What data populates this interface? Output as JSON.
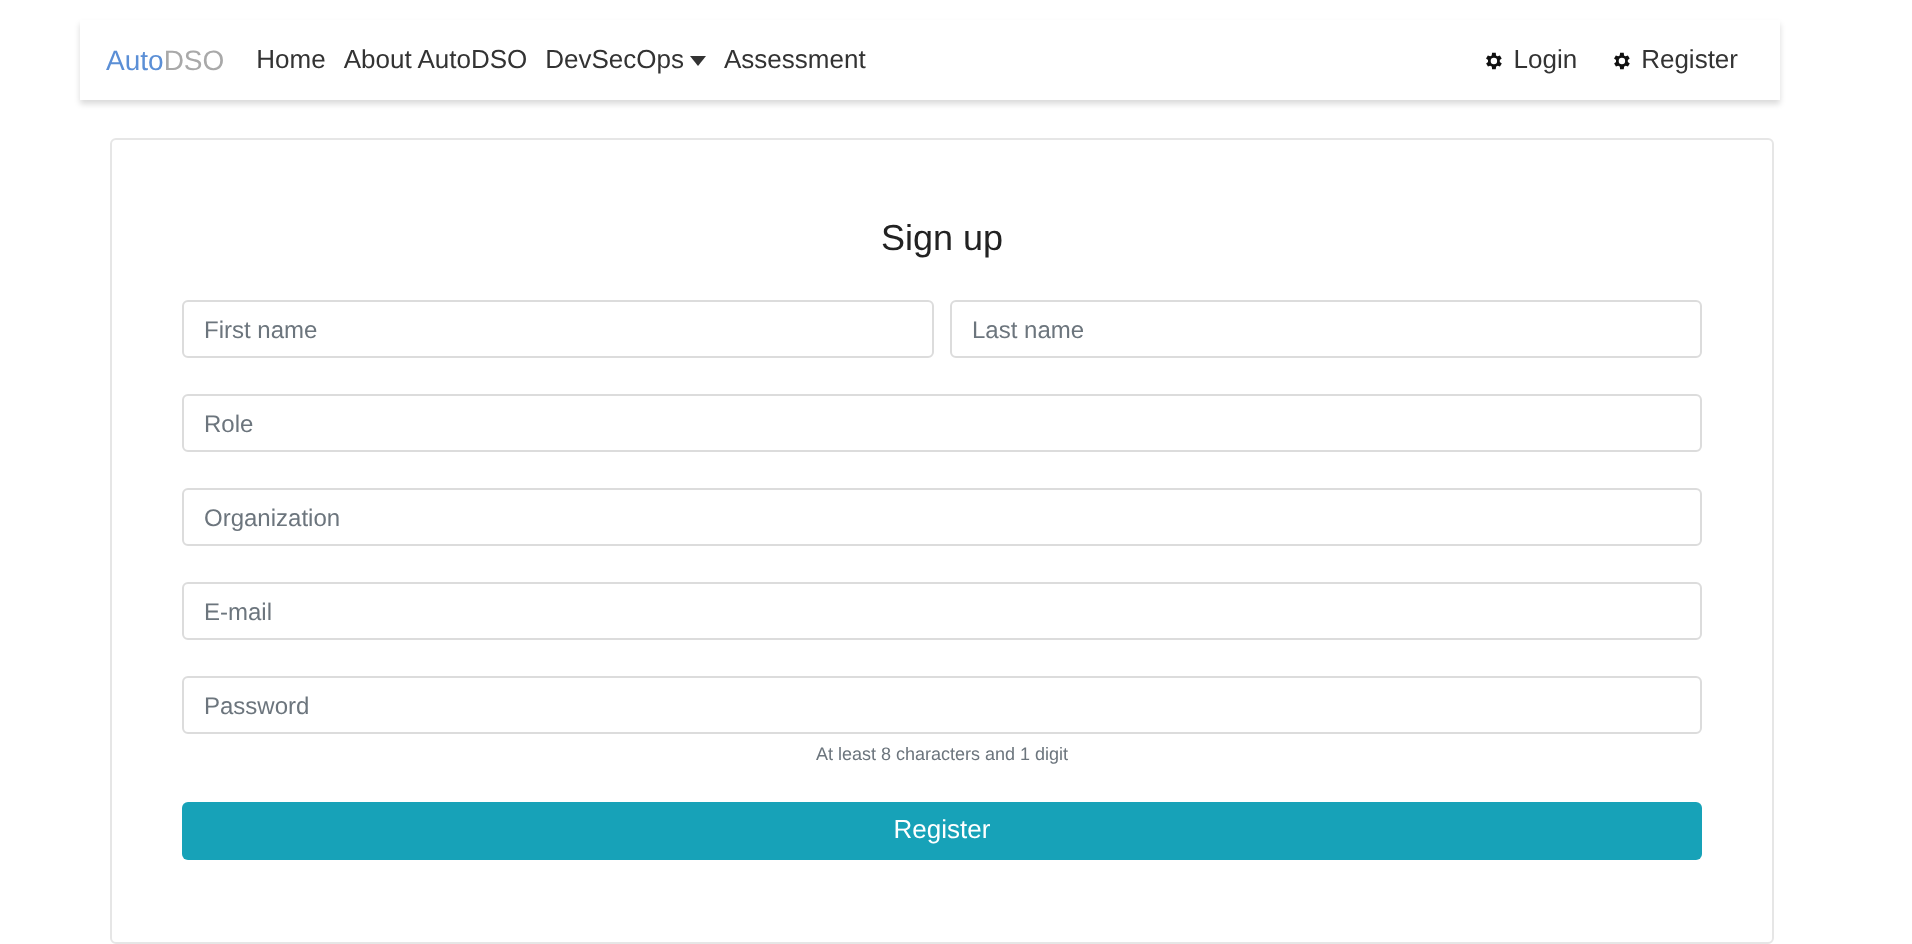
{
  "navbar": {
    "brand": {
      "primary": "Auto",
      "secondary": "DSO"
    },
    "links": [
      {
        "label": "Home",
        "kind": "link"
      },
      {
        "label": "About AutoDSO",
        "kind": "link"
      },
      {
        "label": "DevSecOps",
        "kind": "dropdown"
      },
      {
        "label": "Assessment",
        "kind": "link"
      }
    ],
    "account_links": [
      {
        "label": "Login"
      },
      {
        "label": "Register"
      }
    ]
  },
  "form": {
    "title": "Sign up",
    "rows": [
      [
        {
          "placeholder": "First name"
        },
        {
          "placeholder": "Last name"
        }
      ],
      [
        {
          "placeholder": "Role"
        }
      ],
      [
        {
          "placeholder": "Organization"
        }
      ],
      [
        {
          "placeholder": "E-mail"
        }
      ],
      [
        {
          "placeholder": "Password",
          "hint": "At least 8 characters and 1 digit"
        }
      ]
    ],
    "submit": "Register"
  }
}
